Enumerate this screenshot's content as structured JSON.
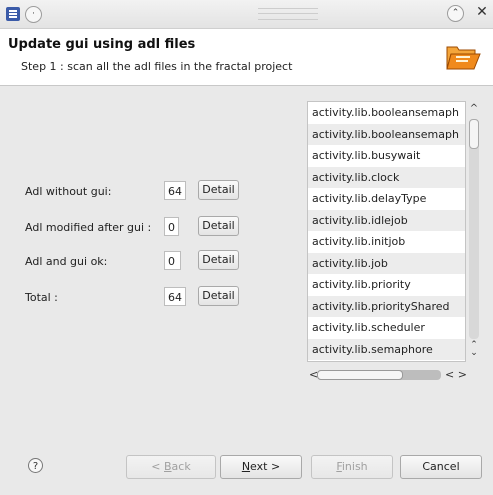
{
  "window": {
    "icons": [
      "app-icon",
      "dot-button-icon",
      "minimize-icon",
      "close-icon"
    ],
    "close_glyph": "✕",
    "minimize_glyph": "⌃"
  },
  "header": {
    "title": "Update gui using adl files",
    "description": "Step 1 : scan all the adl files in the fractal project",
    "banner_icon": "folder-open-icon"
  },
  "stats": {
    "rows": [
      {
        "label": "Adl without gui:",
        "value": "64",
        "button": "Detail"
      },
      {
        "label": "Adl modified after gui :",
        "value": "0",
        "button": "Detail"
      },
      {
        "label": "Adl and gui ok:",
        "value": "0",
        "button": "Detail"
      },
      {
        "label": "Total :",
        "value": "64",
        "button": "Detail"
      }
    ]
  },
  "file_list": {
    "items": [
      "activity.lib.booleansemaph",
      "activity.lib.booleansemaph",
      "activity.lib.busywait",
      "activity.lib.clock",
      "activity.lib.delayType",
      "activity.lib.idlejob",
      "activity.lib.initjob",
      "activity.lib.job",
      "activity.lib.priority",
      "activity.lib.priorityShared",
      "activity.lib.scheduler",
      "activity.lib.semaphore"
    ],
    "scroll_up": "^",
    "scroll_updown": "⌃⌄",
    "scroll_left": "<",
    "scroll_leftright": "< >"
  },
  "footer": {
    "help_label": "?",
    "back_prefix": "< ",
    "back_mnemonic": "B",
    "back_rest": "ack",
    "next_mnemonic": "N",
    "next_rest": "ext >",
    "finish_mnemonic": "F",
    "finish_rest": "inish",
    "cancel_label": "Cancel"
  },
  "colors": {
    "header_bg": "#ffffff",
    "body_bg": "#e9e9e9",
    "banner_orange": "#f08a1c",
    "app_icon_blue": "#3b5ba8"
  }
}
